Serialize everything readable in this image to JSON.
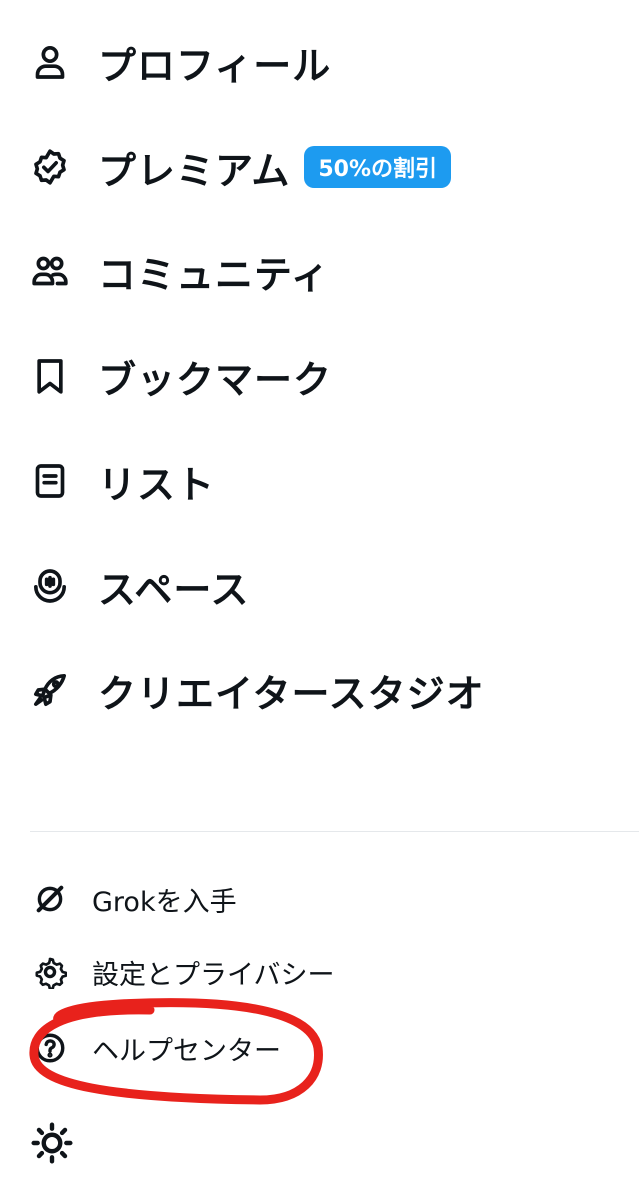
{
  "nav": {
    "profile": {
      "label": "プロフィール",
      "icon": "person-icon"
    },
    "premium": {
      "label": "プレミアム",
      "icon": "verified-badge-icon",
      "badge": "50%の割引",
      "badge_color": "#1d9bf0"
    },
    "communities": {
      "label": "コミュニティ",
      "icon": "communities-icon"
    },
    "bookmarks": {
      "label": "ブックマーク",
      "icon": "bookmark-icon"
    },
    "lists": {
      "label": "リスト",
      "icon": "list-icon"
    },
    "spaces": {
      "label": "スペース",
      "icon": "spaces-icon"
    },
    "creator_studio": {
      "label": "クリエイタースタジオ",
      "icon": "rocket-icon"
    }
  },
  "secondary": {
    "grok": {
      "label": "Grokを入手",
      "icon": "grok-icon"
    },
    "settings": {
      "label": "設定とプライバシー",
      "icon": "gear-icon"
    },
    "help": {
      "label": "ヘルプセンター",
      "icon": "help-circle-icon"
    }
  },
  "theme_toggle": {
    "icon": "sun-icon"
  },
  "annotation": {
    "color": "#e8221c",
    "target": "help"
  }
}
